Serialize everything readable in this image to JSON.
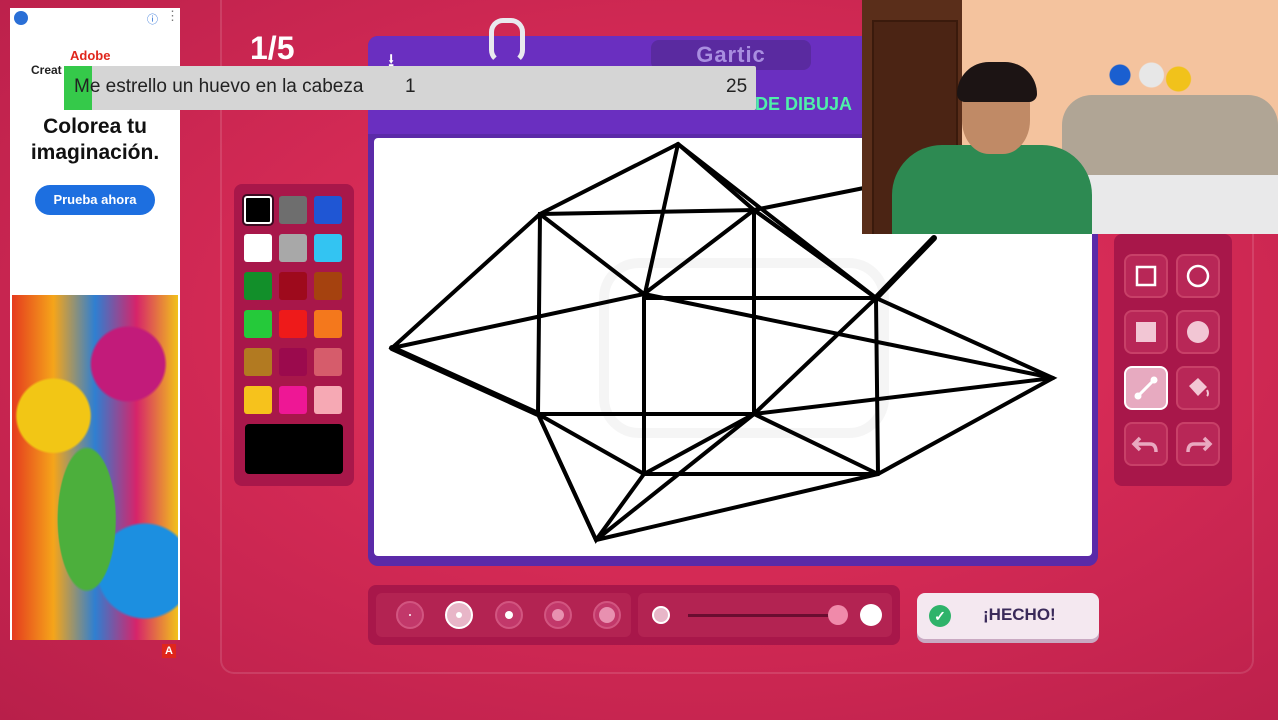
{
  "ad": {
    "brand_line1": "Adobe",
    "brand_line2": "Creat",
    "headline_line1": "Colorea tu",
    "headline_line2": "imaginación.",
    "cta_label": "Prueba ahora",
    "info_glyph": "ⓘ",
    "menu_glyph": "⋮",
    "badge": "A"
  },
  "game": {
    "round_label": "1/5",
    "logo_text": "Gartic",
    "task_text": "DE DIBUJA",
    "done_label": "¡HECHO!"
  },
  "overlay": {
    "phrase": "Me estrello un huevo en la cabeza",
    "value_1": "1",
    "value_2": "25"
  },
  "palette": {
    "colors": [
      "#000000",
      "#6e6e6e",
      "#1f56d4",
      "#ffffff",
      "#a8a8a8",
      "#33c4f2",
      "#128f2a",
      "#9e0a1c",
      "#a5420f",
      "#25c93a",
      "#ee1a1a",
      "#f4781c",
      "#b27a21",
      "#9b0a4d",
      "#d65c6b",
      "#f6c21c",
      "#ee1795",
      "#f6a9b4"
    ],
    "selected_index": 0,
    "current_color": "#000000"
  },
  "tools": {
    "items": [
      "rectangle-outline-tool",
      "ellipse-outline-tool",
      "rectangle-fill-tool",
      "ellipse-fill-tool",
      "line-tool",
      "fill-bucket-tool",
      "undo-tool",
      "redo-tool"
    ],
    "active": "line-tool"
  },
  "brush": {
    "sizes": 5,
    "selected_size_index": 1,
    "opacity_level": 1.0
  }
}
